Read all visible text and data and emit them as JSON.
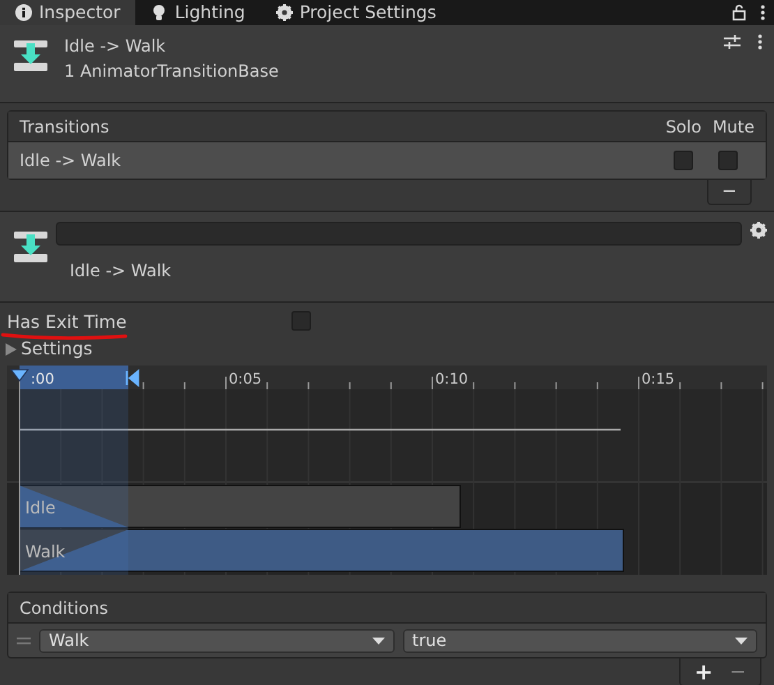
{
  "tabs": [
    {
      "label": "Inspector",
      "selected": true
    },
    {
      "label": "Lighting",
      "selected": false
    },
    {
      "label": "Project Settings",
      "selected": false
    }
  ],
  "header": {
    "title": "Idle -> Walk",
    "subtitle": "1 AnimatorTransitionBase"
  },
  "transitions": {
    "title": "Transitions",
    "columns": [
      "Solo",
      "Mute"
    ],
    "rows": [
      {
        "label": "Idle -> Walk",
        "solo": false,
        "mute": false
      }
    ],
    "remove_button": "−"
  },
  "transition": {
    "label": "Idle -> Walk"
  },
  "has_exit_time": {
    "label": "Has Exit Time",
    "checked": false
  },
  "settings": {
    "label": "Settings",
    "expanded": false
  },
  "timeline": {
    "tick_labels": [
      ":00",
      "0:05",
      "0:10",
      "0:15"
    ],
    "tracks": [
      {
        "label": "Idle",
        "selected": false
      },
      {
        "label": "Walk",
        "selected": true
      }
    ]
  },
  "conditions": {
    "title": "Conditions",
    "rows": [
      {
        "parameter": "Walk",
        "value": "true"
      }
    ],
    "add_button": "+",
    "remove_button": "−"
  }
}
